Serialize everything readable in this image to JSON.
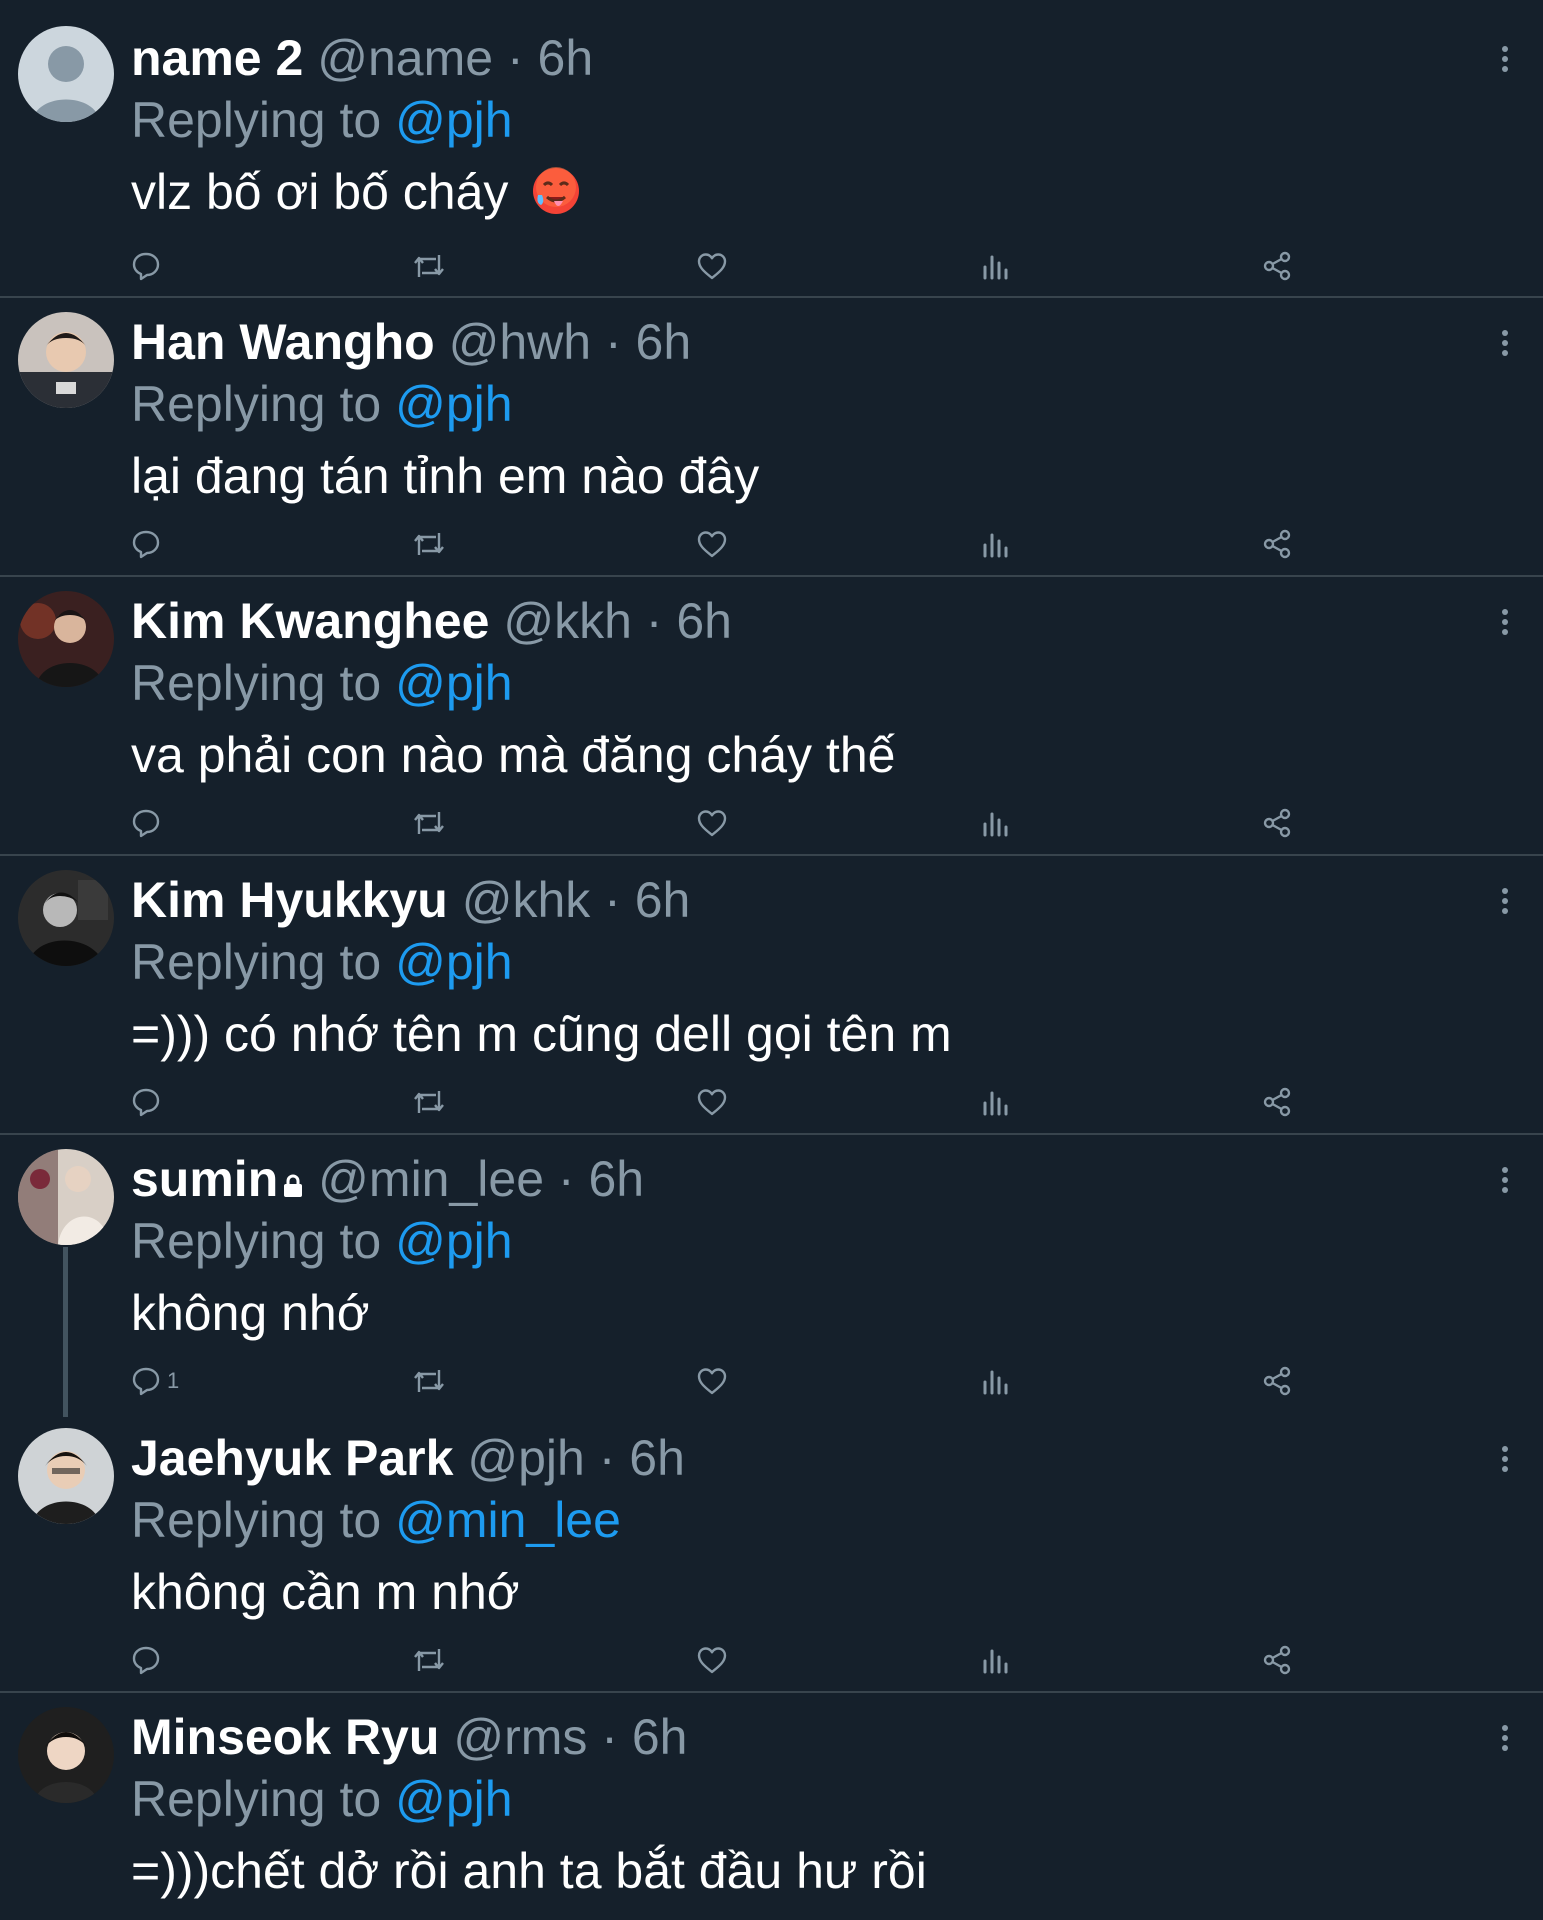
{
  "tweets": [
    {
      "name": "name 2",
      "handle": "@name",
      "dot": "·",
      "time": "6h",
      "replying_prefix": "Replying to",
      "replying_to": "@pjh",
      "text": "vlz bố ơi bố cháy",
      "emoji": "hot-face-emoji",
      "reply_count": ""
    },
    {
      "name": "Han Wangho",
      "handle": "@hwh",
      "dot": "·",
      "time": "6h",
      "replying_prefix": "Replying to",
      "replying_to": "@pjh",
      "text": "lại đang tán tỉnh em nào đây",
      "reply_count": ""
    },
    {
      "name": "Kim Kwanghee",
      "handle": "@kkh",
      "dot": "·",
      "time": "6h",
      "replying_prefix": "Replying to",
      "replying_to": "@pjh",
      "text": "va phải con nào mà đăng cháy thế",
      "reply_count": ""
    },
    {
      "name": "Kim Hyukkyu",
      "handle": "@khk",
      "dot": "·",
      "time": "6h",
      "replying_prefix": "Replying to",
      "replying_to": "@pjh",
      "text": "=))) có nhớ tên m cũng dell gọi tên m",
      "reply_count": ""
    },
    {
      "name": "sumin",
      "locked": true,
      "handle": "@min_lee",
      "dot": "·",
      "time": "6h",
      "replying_prefix": "Replying to",
      "replying_to": "@pjh",
      "text": "không nhớ",
      "reply_count": "1"
    },
    {
      "name": "Jaehyuk Park",
      "handle": "@pjh",
      "dot": "·",
      "time": "6h",
      "replying_prefix": "Replying to",
      "replying_to": "@min_lee",
      "text": "không cần m nhớ",
      "reply_count": ""
    },
    {
      "name": "Minseok Ryu",
      "handle": "@rms",
      "dot": "·",
      "time": "6h",
      "replying_prefix": "Replying to",
      "replying_to": "@pjh",
      "text": "=)))chết dở rồi anh ta bắt đầu hư rồi",
      "reply_count": ""
    }
  ],
  "icons": {
    "reply": "reply-icon",
    "retweet": "retweet-icon",
    "like": "like-icon",
    "views": "views-icon",
    "share": "share-icon",
    "more": "more-icon",
    "lock": "lock-icon"
  },
  "colors": {
    "background": "#15202b",
    "divider": "#38444d",
    "muted_text": "#8899a6",
    "link": "#1d9bf0",
    "primary_text": "#ffffff"
  }
}
